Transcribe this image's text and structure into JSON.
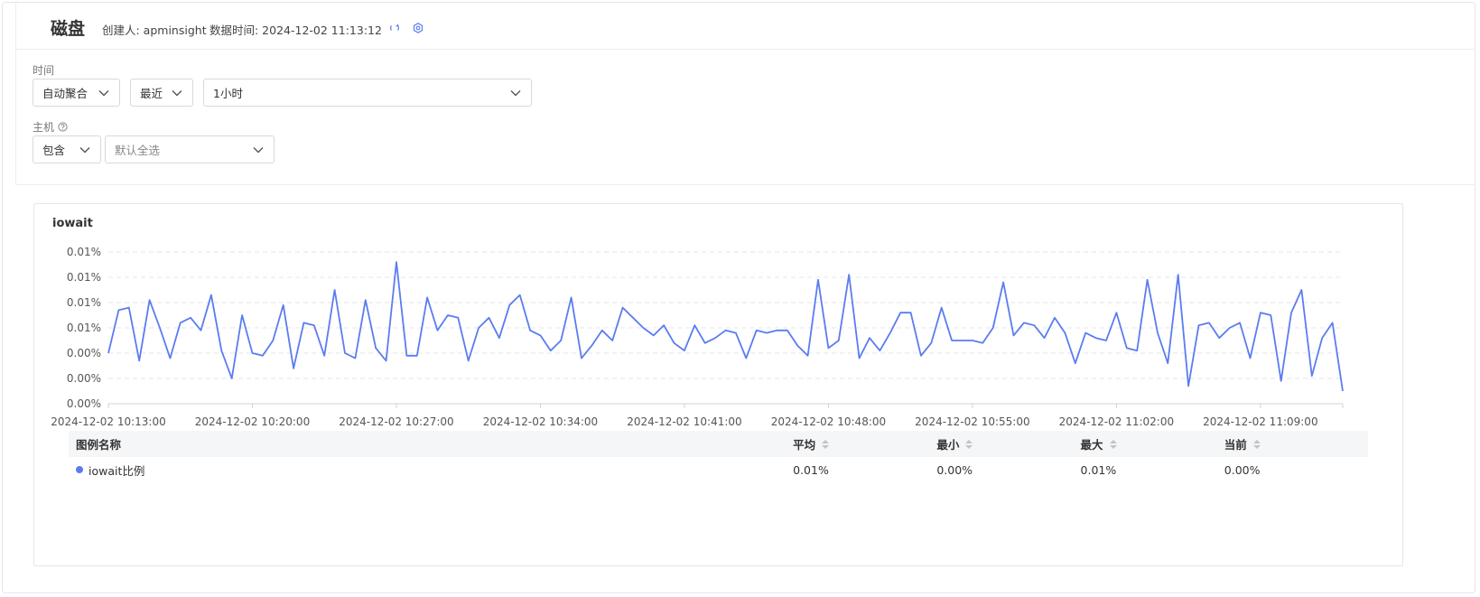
{
  "header": {
    "title": "磁盘",
    "creator": "创建人: apminsight",
    "data_time": "数据时间: 2024-12-02 11:13:12",
    "icons": [
      "refresh-icon",
      "settings-icon"
    ]
  },
  "filters": {
    "time_label": "时间",
    "aggregation": "自动聚合",
    "range_mode": "最近",
    "range_value": "1小时",
    "host_label": "主机",
    "host_mode": "包含",
    "host_placeholder": "默认全选"
  },
  "colors": {
    "accent": "#5b7cf0",
    "series": "#5b7cf0",
    "grid": "#e3e5e9"
  },
  "chart_data": {
    "type": "line",
    "title": "iowait",
    "y_tick_labels": [
      "0.00%",
      "0.00%",
      "0.00%",
      "0.01%",
      "0.01%",
      "0.01%",
      "0.01%"
    ],
    "x_tick_labels": [
      "2024-12-02 10:13:00",
      "2024-12-02 10:20:00",
      "2024-12-02 10:27:00",
      "2024-12-02 10:34:00",
      "2024-12-02 10:41:00",
      "2024-12-02 10:48:00",
      "2024-12-02 10:55:00",
      "2024-12-02 11:02:00",
      "2024-12-02 11:09:00"
    ],
    "x_start": "2024-12-02 10:13:00",
    "x_tick_interval_minutes": 7,
    "point_interval_minutes": 0.5,
    "ylim": [
      0,
      6
    ],
    "grid": true,
    "series": [
      {
        "name": "iowait比例",
        "values": [
          2.0,
          3.7,
          3.8,
          1.7,
          4.1,
          3.0,
          1.8,
          3.2,
          3.4,
          2.9,
          4.3,
          2.1,
          1.0,
          3.5,
          2.0,
          1.9,
          2.5,
          3.9,
          1.4,
          3.2,
          3.1,
          1.9,
          4.5,
          2.0,
          1.8,
          4.1,
          2.2,
          1.7,
          5.6,
          1.9,
          1.9,
          4.2,
          2.9,
          3.5,
          3.4,
          1.7,
          3.0,
          3.4,
          2.6,
          3.9,
          4.3,
          2.9,
          2.7,
          2.1,
          2.5,
          4.2,
          1.8,
          2.3,
          2.9,
          2.5,
          3.8,
          3.4,
          3.0,
          2.7,
          3.1,
          2.4,
          2.1,
          3.1,
          2.4,
          2.6,
          2.9,
          2.8,
          1.8,
          2.9,
          2.8,
          2.9,
          2.9,
          2.3,
          1.9,
          4.9,
          2.2,
          2.5,
          5.1,
          1.8,
          2.6,
          2.1,
          2.8,
          3.6,
          3.6,
          1.9,
          2.4,
          3.8,
          2.5,
          2.5,
          2.5,
          2.4,
          3.0,
          4.8,
          2.7,
          3.2,
          3.1,
          2.6,
          3.4,
          2.8,
          1.6,
          2.8,
          2.6,
          2.5,
          3.6,
          2.2,
          2.1,
          4.9,
          2.8,
          1.6,
          5.1,
          0.7,
          3.1,
          3.2,
          2.6,
          3.0,
          3.2,
          1.8,
          3.6,
          3.5,
          0.9,
          3.6,
          4.5,
          1.1,
          2.6,
          3.2,
          0.5
        ]
      }
    ]
  },
  "legend_table": {
    "headers": {
      "name": "图例名称",
      "avg": "平均",
      "min": "最小",
      "max": "最大",
      "current": "当前"
    },
    "rows": [
      {
        "name": "iowait比例",
        "avg": "0.01%",
        "min": "0.00%",
        "max": "0.01%",
        "current": "0.00%"
      }
    ]
  }
}
